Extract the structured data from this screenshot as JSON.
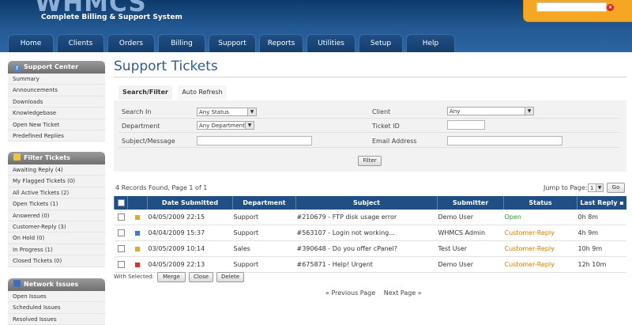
{
  "header": {
    "logo": "WHMCS",
    "tagline": "Complete Billing & Support System",
    "search": {
      "value": "",
      "placeholder": ""
    }
  },
  "nav": {
    "tabs": [
      {
        "label": "Home"
      },
      {
        "label": "Clients"
      },
      {
        "label": "Orders"
      },
      {
        "label": "Billing"
      },
      {
        "label": "Support"
      },
      {
        "label": "Reports"
      },
      {
        "label": "Utilities"
      },
      {
        "label": "Setup"
      },
      {
        "label": "Help"
      }
    ]
  },
  "sidebar": {
    "support_center": {
      "title": "Support Center",
      "items": [
        "Summary",
        "Announcements",
        "Downloads",
        "Knowledgebase",
        "Open New Ticket",
        "Predefined Replies"
      ]
    },
    "filter_tickets": {
      "title": "Filter Tickets",
      "items": [
        "Awaiting Reply (4)",
        "My Flagged Tickets (0)",
        "All Active Tickets (2)",
        "Open Tickets (1)",
        "Answered (0)",
        "Customer-Reply (3)",
        "On Hold (0)",
        "In Progress (1)",
        "Closed Tickets (0)"
      ]
    },
    "network_issues": {
      "title": "Network Issues",
      "items": [
        "Open Issues",
        "Scheduled Issues",
        "Resolved Issues"
      ]
    }
  },
  "main": {
    "title": "Support Tickets",
    "tabs": {
      "search": "Search/Filter",
      "refresh": "Auto Refresh"
    },
    "filter": {
      "search_in_label": "Search In",
      "search_in_value": "Any Status",
      "department_label": "Department",
      "department_value": "Any Department",
      "subject_label": "Subject/Message",
      "subject_value": "",
      "client_label": "Client",
      "client_value": "Any",
      "ticket_id_label": "Ticket ID",
      "ticket_id_value": "",
      "email_label": "Email Address",
      "email_value": "",
      "filter_button": "Filter"
    },
    "records_text": "4 Records Found, Page 1 of 1",
    "jump_label": "Jump to Page:",
    "jump_value": "1",
    "go_button": "Go",
    "table": {
      "headers": [
        "Date Submitted",
        "Department",
        "Subject",
        "Submitter",
        "Status",
        "Last Reply"
      ],
      "rows": [
        {
          "date": "04/05/2009 22:15",
          "department": "Support",
          "subject": "#210679 - FTP disk usage error",
          "submitter": "Demo User",
          "status": "Open",
          "last_reply": "0h 8m",
          "flag_color": "#e8a33a"
        },
        {
          "date": "04/04/2009 15:37",
          "department": "Support",
          "subject": "#563107 - Login not working...",
          "submitter": "WHMCS Admin",
          "status": "Customer-Reply",
          "last_reply": "4h 9m",
          "flag_color": "#3a7bd5"
        },
        {
          "date": "03/05/2009 10:14",
          "department": "Sales",
          "subject": "#390648 - Do you offer cPanel?",
          "submitter": "Test User",
          "status": "Customer-Reply",
          "last_reply": "10h 9m",
          "flag_color": "#e8a33a"
        },
        {
          "date": "04/05/2009 22:13",
          "department": "Support",
          "subject": "#675871 - Help! Urgent",
          "submitter": "Demo User",
          "status": "Customer-Reply",
          "last_reply": "12h 10m",
          "flag_color": "#d8322b"
        }
      ]
    },
    "with_selected_label": "With Selected:",
    "actions": {
      "merge": "Merge",
      "close": "Close",
      "delete": "Delete"
    },
    "pager": {
      "prev": "« Previous Page",
      "next": "Next Page »"
    }
  },
  "colors": {
    "open": "#2e9b2e",
    "customer_reply": "#e07b00",
    "nav_bg": "#1f4f85",
    "title": "#2f5d94"
  }
}
